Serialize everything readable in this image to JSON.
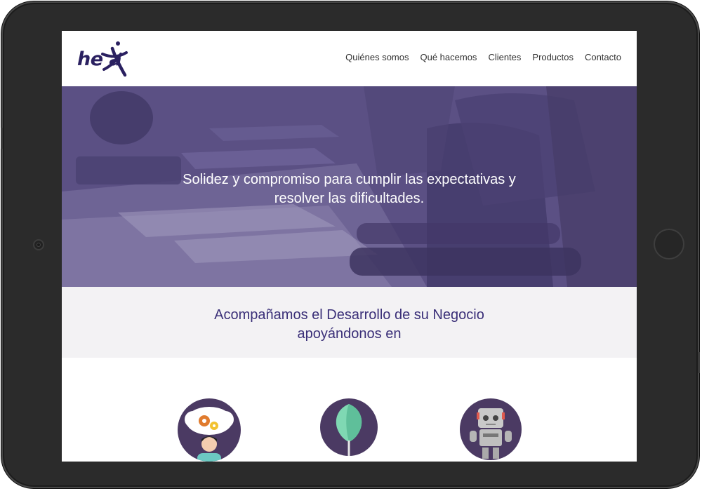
{
  "logo": {
    "text": "he a"
  },
  "nav": {
    "items": [
      "Quiénes somos",
      "Qué hacemos",
      "Clientes",
      "Productos",
      "Contacto"
    ]
  },
  "hero": {
    "line1": "Solidez y compromiso para cumplir las expectativas y",
    "line2": "resolver las dificultades."
  },
  "intro": {
    "line1": "Acompañamos el Desarrollo de su Negocio",
    "line2": "apoyándonos en"
  },
  "services": {
    "icons": [
      "thinking-person-icon",
      "tree-icon",
      "robot-icon"
    ]
  },
  "colors": {
    "brand": "#2a2060",
    "hero_overlay": "#5a4f84",
    "heading": "#3a2f78",
    "icon_circle": "#4b3a63",
    "device_frame": "#2b2b2b"
  }
}
